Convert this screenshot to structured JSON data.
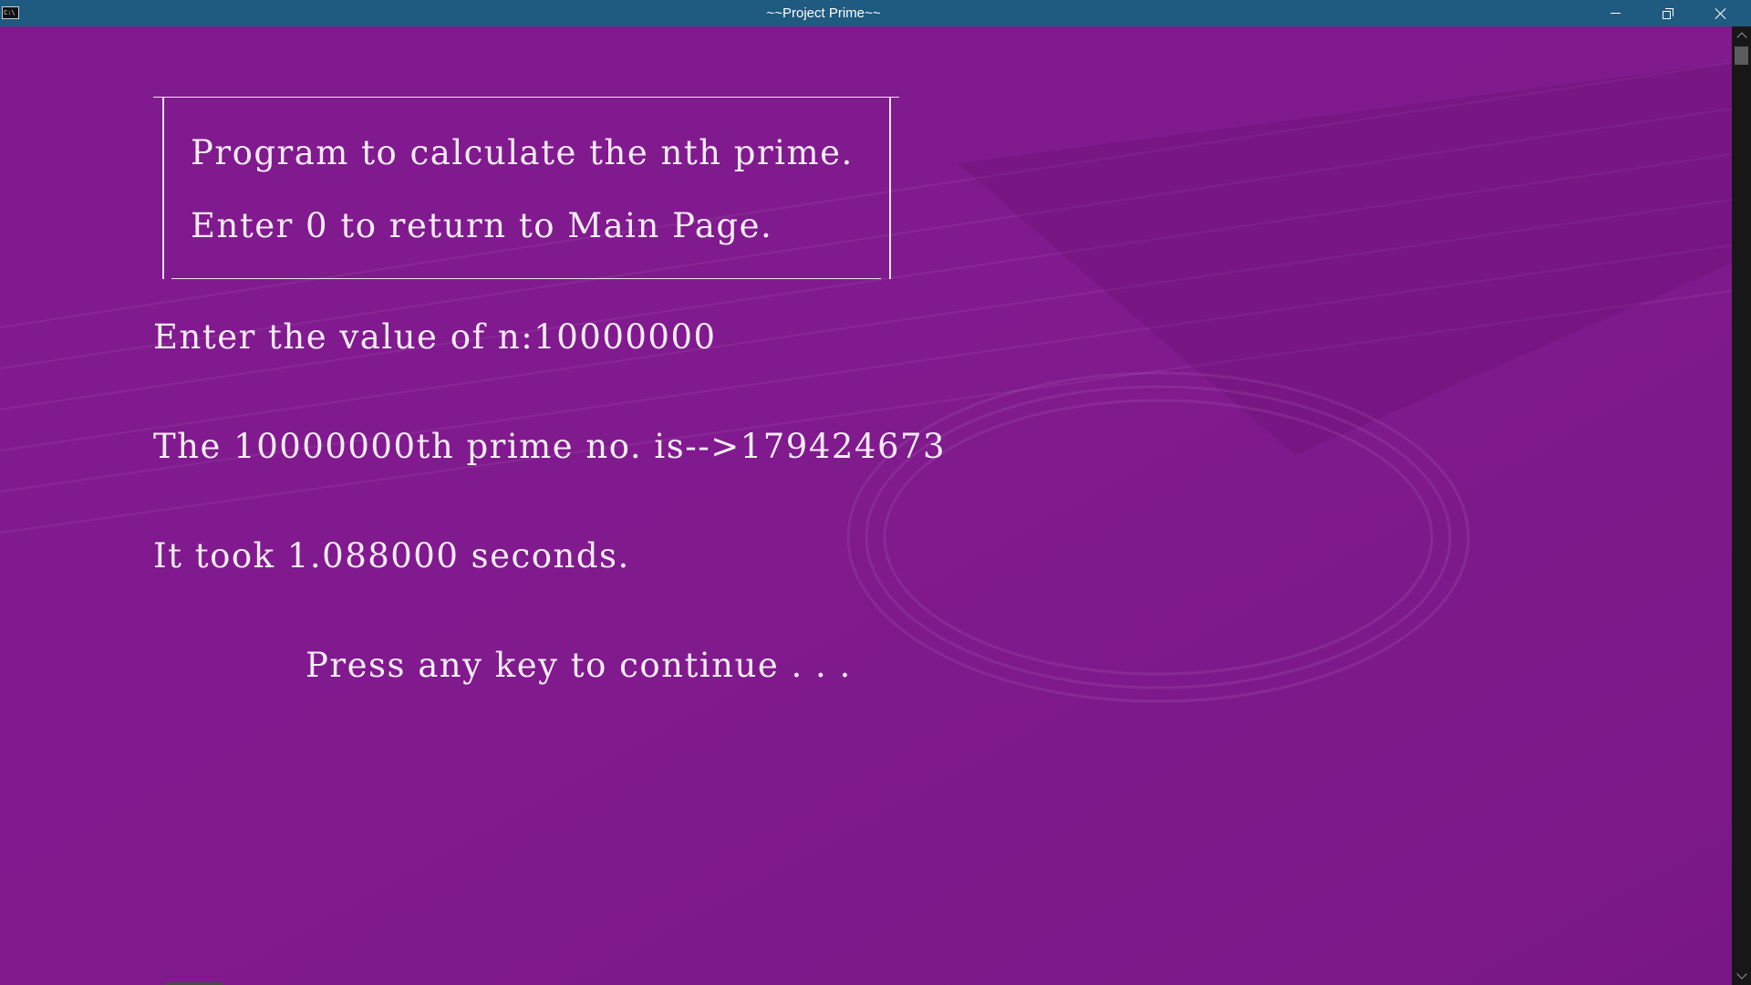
{
  "window": {
    "title": "~~Project Prime~~",
    "icon_text": "C:\\",
    "controls": {
      "minimize": "minimize-icon",
      "restore": "restore-icon",
      "close": "close-icon"
    }
  },
  "console": {
    "background_color": "#811a8e",
    "text_color": "#f6ecf7",
    "banner": {
      "line1": "Program to calculate the nth prime.",
      "line2": "Enter 0 to return to Main Page."
    },
    "prompt": "Enter the value of n:10000000",
    "result": "The 10000000th prime no. is-->179424673",
    "timing": "It took 1.088000 seconds.",
    "continue_prompt": "Press any key to continue . . ."
  }
}
